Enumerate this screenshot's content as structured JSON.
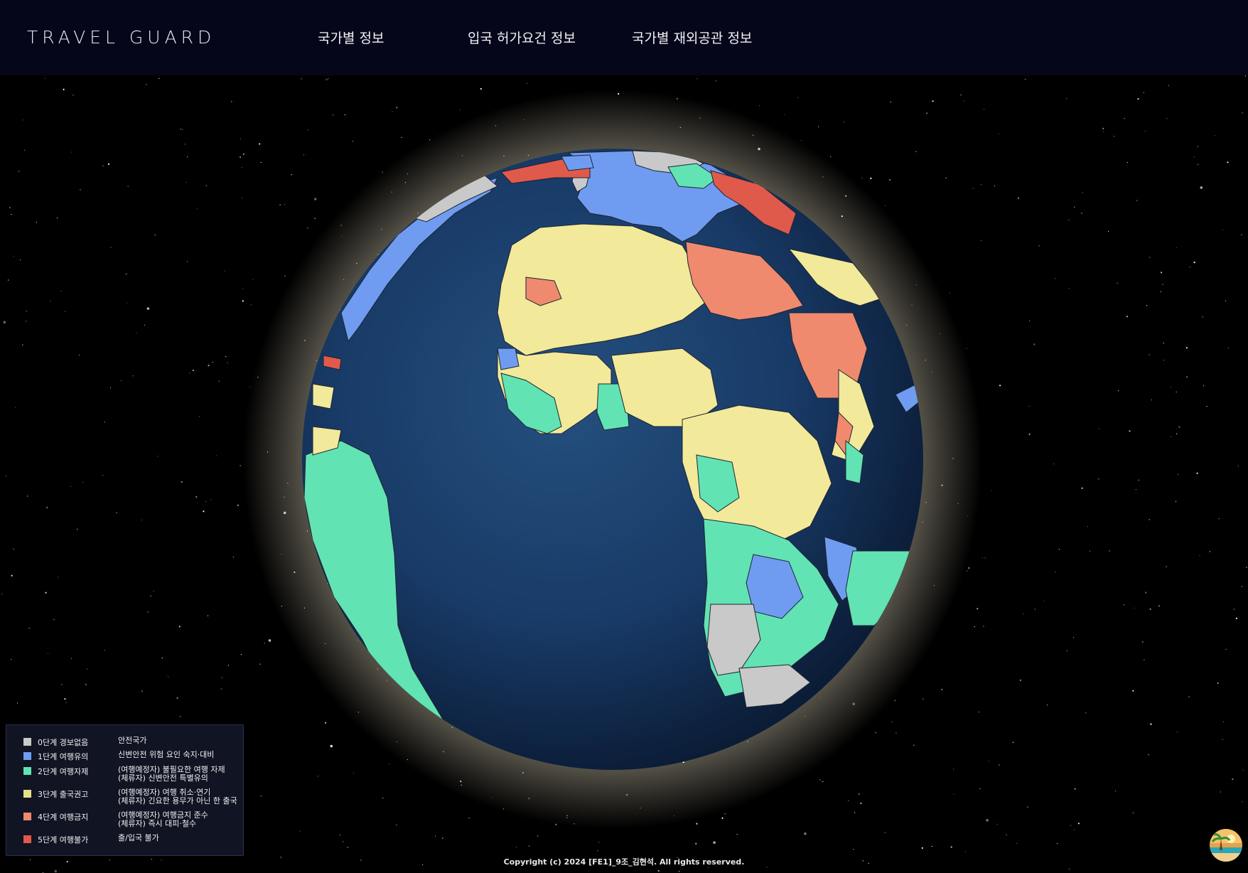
{
  "header": {
    "logo": "TRAVEL GUARD",
    "nav": [
      {
        "label": "국가별 정보"
      },
      {
        "label": "입국 허가요건 정보"
      },
      {
        "label": "국가별 재외공관 정보"
      }
    ]
  },
  "legend": {
    "levels": [
      {
        "level": "0단계 경보없음",
        "lines": [
          "안전국가"
        ],
        "color": "#c9c9c9"
      },
      {
        "level": "1단계 여행유의",
        "lines": [
          "신변안전 위험 요인 숙지·대비"
        ],
        "color": "#6f9cf0"
      },
      {
        "level": "2단계 여행자제",
        "lines": [
          "(여행예정자) 불필요한 여행 자제",
          "(체류자) 신변안전 특별유의"
        ],
        "color": "#62e3b3"
      },
      {
        "level": "3단계 출국권고",
        "lines": [
          "(여행예정자) 여행 취소·연기",
          "(체류자) 긴요한 용무가 아닌 한 출국"
        ],
        "color": "#e6df8b"
      },
      {
        "level": "4단계 여행금지",
        "lines": [
          "(여행예정자) 여행금지 준수",
          "(체류자) 즉시 대피·철수"
        ],
        "color": "#ef8a6f"
      },
      {
        "level": "5단계 여행불가",
        "lines": [
          "출/입국 불가"
        ],
        "color": "#e05a4c"
      }
    ]
  },
  "footer": {
    "copyright": "Copyright (c) 2024 [FE1]_9조_김현석. All rights reserved."
  },
  "colors": {
    "header_bg": "#05061a",
    "ocean": "#16345e",
    "safe": "#c9c9c9",
    "caution": "#6f9cf0",
    "restrain": "#62e3b3",
    "recommend_leave": "#f2e99a",
    "ban": "#ef8a6f",
    "prohibited": "#e05a4c"
  },
  "icons": {
    "chat_avatar": "beach-avatar-icon"
  }
}
